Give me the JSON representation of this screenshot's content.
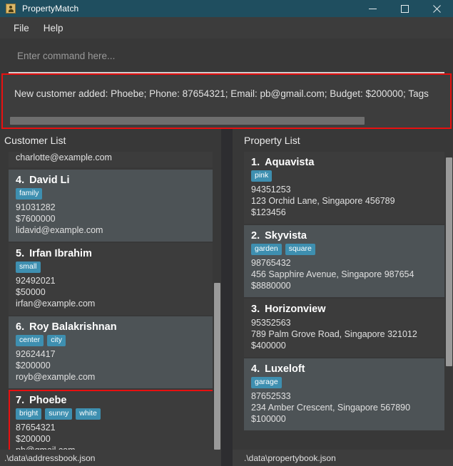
{
  "window": {
    "title": "PropertyMatch",
    "icon": "person-app-icon",
    "controls": {
      "minimize_label": "Minimize",
      "maximize_label": "Maximize",
      "close_label": "Close"
    }
  },
  "menubar": {
    "items": [
      {
        "label": "File"
      },
      {
        "label": "Help"
      }
    ]
  },
  "command": {
    "placeholder": "Enter command here...",
    "value": ""
  },
  "result": {
    "text": "New customer added: Phoebe; Phone: 87654321; Email: pb@gmail.com; Budget: $200000; Tags",
    "highlight_color": "#e81010"
  },
  "customer_panel": {
    "header": "Customer List",
    "status": ".\\data\\addressbook.json",
    "items": [
      {
        "clipped": true,
        "index": "",
        "name": "",
        "tags": [],
        "lines": [
          "charlotte@example.com"
        ],
        "selected": false,
        "highlighted": false
      },
      {
        "clipped": false,
        "index": "4.",
        "name": "David Li",
        "tags": [
          "family"
        ],
        "lines": [
          "91031282",
          "$7600000",
          "lidavid@example.com"
        ],
        "selected": true,
        "highlighted": false
      },
      {
        "clipped": false,
        "index": "5.",
        "name": "Irfan Ibrahim",
        "tags": [
          "small"
        ],
        "lines": [
          "92492021",
          "$50000",
          "irfan@example.com"
        ],
        "selected": false,
        "highlighted": false
      },
      {
        "clipped": false,
        "index": "6.",
        "name": "Roy Balakrishnan",
        "tags": [
          "center",
          "city"
        ],
        "lines": [
          "92624417",
          "$200000",
          "royb@example.com"
        ],
        "selected": true,
        "highlighted": false
      },
      {
        "clipped": false,
        "index": "7.",
        "name": "Phoebe",
        "tags": [
          "bright",
          "sunny",
          "white"
        ],
        "lines": [
          "87654321",
          "$200000",
          "pb@gmail.com"
        ],
        "selected": false,
        "highlighted": true
      }
    ],
    "scrollbar": {
      "thumb_top_pct": 44,
      "thumb_height_pct": 56
    }
  },
  "property_panel": {
    "header": "Property List",
    "status": ".\\data\\propertybook.json",
    "items": [
      {
        "index": "1.",
        "name": "Aquavista",
        "tags": [
          "pink"
        ],
        "lines": [
          "94351253",
          "123 Orchid Lane, Singapore 456789",
          "$123456"
        ],
        "selected": false
      },
      {
        "index": "2.",
        "name": "Skyvista",
        "tags": [
          "garden",
          "square"
        ],
        "lines": [
          "98765432",
          "456 Sapphire Avenue, Singapore 987654",
          "$8880000"
        ],
        "selected": true
      },
      {
        "index": "3.",
        "name": "Horizonview",
        "tags": [],
        "lines": [
          "95352563",
          "789 Palm Grove Road, Singapore 321012",
          "$400000"
        ],
        "selected": false
      },
      {
        "index": "4.",
        "name": "Luxeloft",
        "tags": [
          "garage"
        ],
        "lines": [
          "87652533",
          "234 Amber Crescent, Singapore 567890",
          "$100000"
        ],
        "selected": true
      }
    ],
    "scrollbar": {
      "thumb_top_pct": 2,
      "thumb_height_pct": 70
    }
  },
  "colors": {
    "titlebar": "#1f4e5f",
    "tag": "#3e8fb0",
    "selection": "#4d5356",
    "highlight_border": "#e81010",
    "panel_bg": "#383838",
    "card_bg": "#3c3c3c"
  }
}
